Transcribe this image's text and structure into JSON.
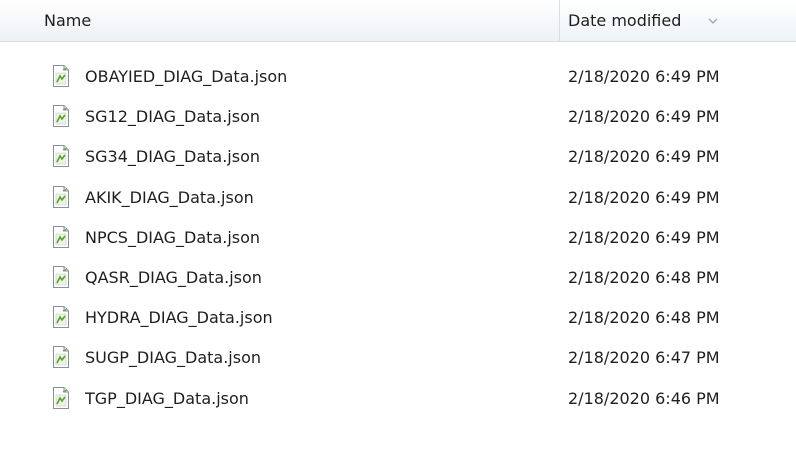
{
  "header": {
    "name_label": "Name",
    "date_label": "Date modified",
    "sort_icon": "chevron-down-icon"
  },
  "files": [
    {
      "name": "OBAYIED_DIAG_Data.json",
      "date": "2/18/2020 6:49 PM"
    },
    {
      "name": "SG12_DIAG_Data.json",
      "date": "2/18/2020 6:49 PM"
    },
    {
      "name": "SG34_DIAG_Data.json",
      "date": "2/18/2020 6:49 PM"
    },
    {
      "name": "AKIK_DIAG_Data.json",
      "date": "2/18/2020 6:49 PM"
    },
    {
      "name": "NPCS_DIAG_Data.json",
      "date": "2/18/2020 6:49 PM"
    },
    {
      "name": "QASR_DIAG_Data.json",
      "date": "2/18/2020 6:48 PM"
    },
    {
      "name": "HYDRA_DIAG_Data.json",
      "date": "2/18/2020 6:48 PM"
    },
    {
      "name": "SUGP_DIAG_Data.json",
      "date": "2/18/2020 6:47 PM"
    },
    {
      "name": "TGP_DIAG_Data.json",
      "date": "2/18/2020 6:46 PM"
    }
  ],
  "file_icon": "json-file-icon"
}
